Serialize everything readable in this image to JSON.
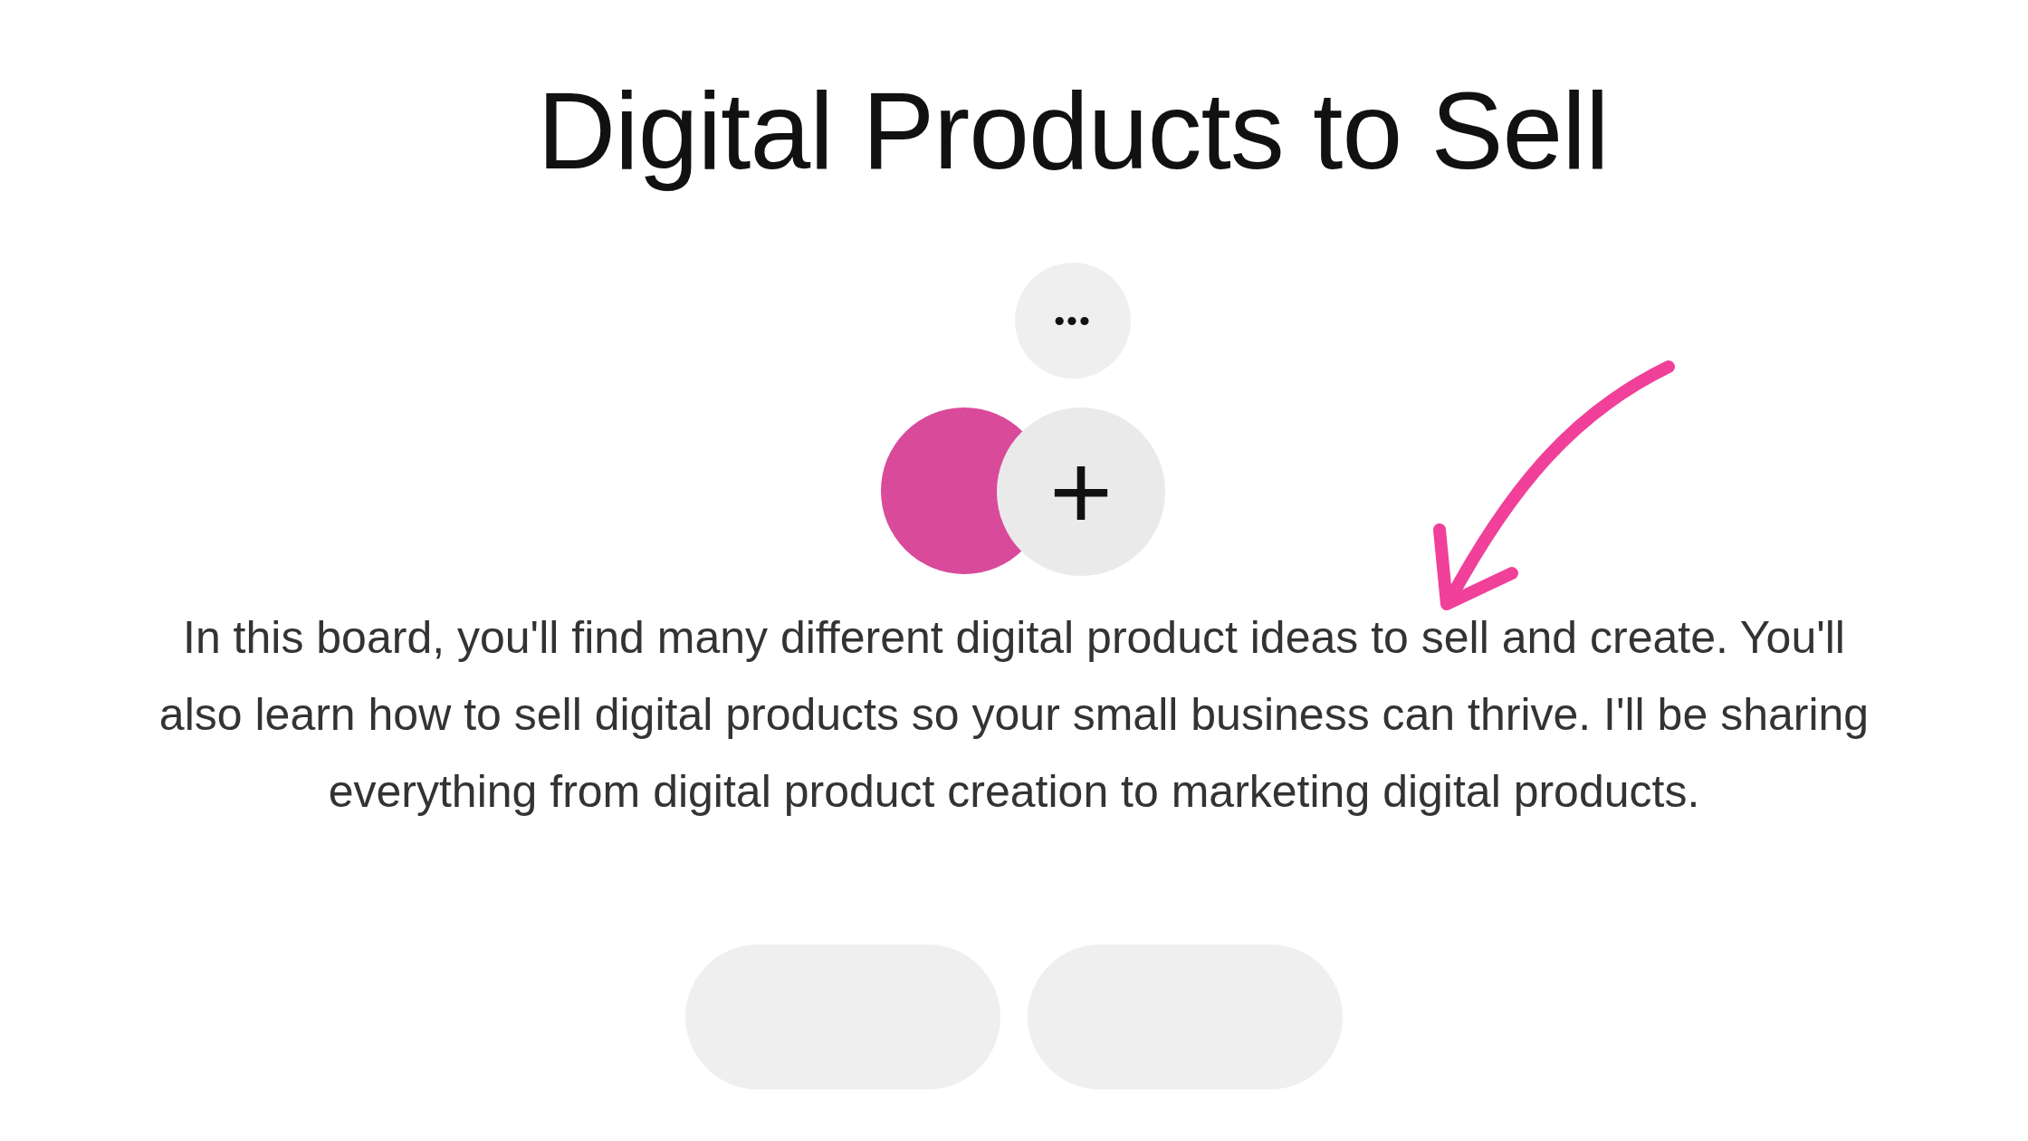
{
  "board": {
    "title": "Digital Products to Sell",
    "more_button": {
      "label": "•••"
    },
    "add_collaborator_button": {
      "label": "+"
    },
    "description": "In this board, you'll find many different digital product ideas to sell and create. You'll also learn how to sell digital products so your small business can thrive. I'll be sharing everything from digital product creation to marketing digital products."
  }
}
